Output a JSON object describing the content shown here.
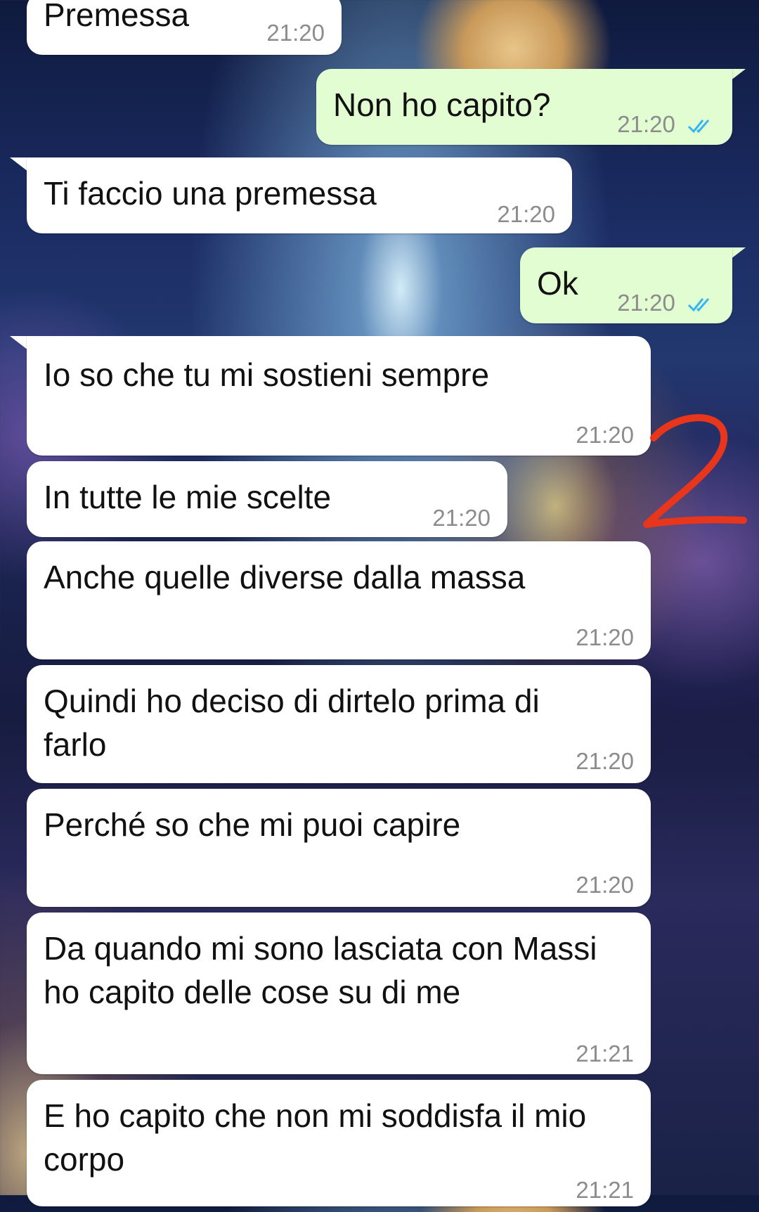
{
  "messages": [
    {
      "direction": "in",
      "text": "Premessa",
      "time": "21:20"
    },
    {
      "direction": "out",
      "text": "Non ho capito?",
      "time": "21:20",
      "status": "read"
    },
    {
      "direction": "in",
      "text": "Ti faccio una premessa",
      "time": "21:20"
    },
    {
      "direction": "out",
      "text": "Ok",
      "time": "21:20",
      "status": "read"
    },
    {
      "direction": "in",
      "text": "Io so che tu mi sostieni sempre",
      "time": "21:20"
    },
    {
      "direction": "in",
      "text": "In tutte le mie scelte",
      "time": "21:20"
    },
    {
      "direction": "in",
      "text": "Anche quelle diverse dalla massa",
      "time": "21:20"
    },
    {
      "direction": "in",
      "text": "Quindi ho deciso di dirtelo prima di farlo",
      "time": "21:20"
    },
    {
      "direction": "in",
      "text": "Perché so che mi puoi capire",
      "time": "21:20"
    },
    {
      "direction": "in",
      "text": "Da quando mi sono lasciata con Massi ho capito delle cose su di me",
      "time": "21:21"
    },
    {
      "direction": "in",
      "text": "E ho capito che non mi soddisfa il mio corpo",
      "time": "21:21"
    }
  ],
  "annotation": {
    "text": "2",
    "color": "#e8361d"
  },
  "colors": {
    "incoming_bubble": "#ffffff",
    "outgoing_bubble": "#e3fdd3",
    "read_ticks": "#34b7f1",
    "timestamp": "#8c8c8c"
  },
  "icons": {
    "read_status": "double-check-icon"
  }
}
